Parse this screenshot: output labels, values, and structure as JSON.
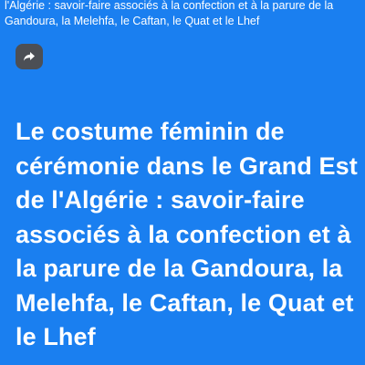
{
  "post": {
    "caption_preview": "l'Algérie : savoir-faire associés à la confection et à la parure de la Gandoura, la Melehfa, le Caftan, le Quat et le Lhef",
    "share_icon": "share-arrow-icon",
    "headline": "Le costume féminin de cérémonie dans le Grand Est de l'Algérie : savoir-faire associés à la confection et à la parure de la Gandoura, la Melehfa, le Caftan, le Quat et le Lhef"
  },
  "colors": {
    "background": "#1a7ff0",
    "share_button_bg": "#4c4f55",
    "text": "#ffffff"
  }
}
